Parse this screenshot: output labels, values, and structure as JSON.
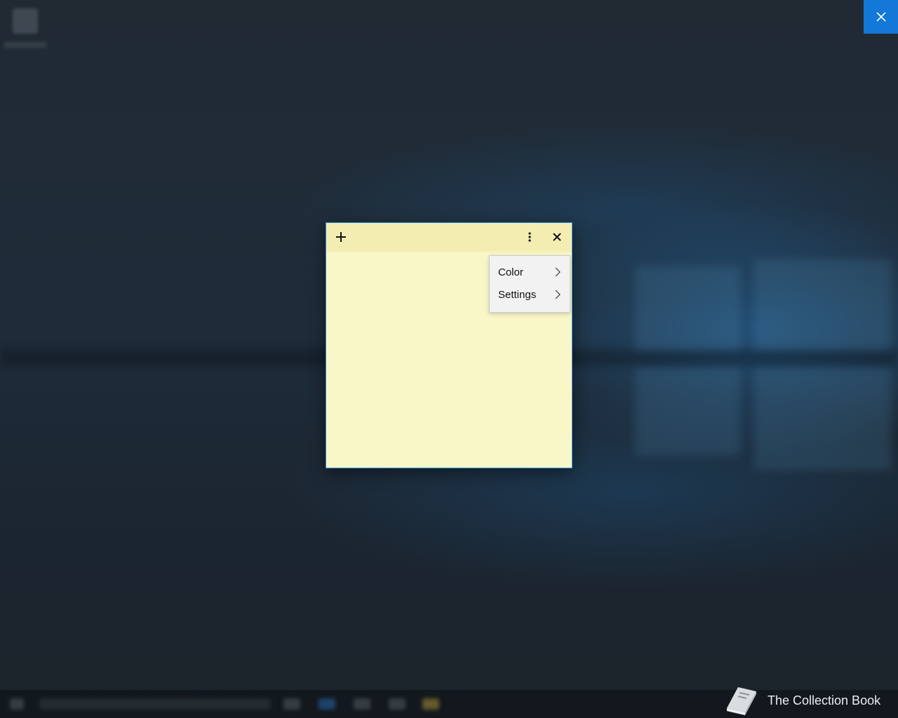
{
  "overlay": {
    "close_icon": "close-icon"
  },
  "note": {
    "add_icon": "plus-icon",
    "menu_icon": "more-vertical-icon",
    "close_icon": "close-icon",
    "background_color": "#f9f6c7",
    "header_color": "#f3edb2"
  },
  "menu": {
    "items": [
      {
        "label": "Color",
        "icon": "chevron-right-icon"
      },
      {
        "label": "Settings",
        "icon": "chevron-right-icon"
      }
    ]
  },
  "watermark": {
    "text": "The Collection Book",
    "icon": "book-icon"
  },
  "colors": {
    "accent": "#1378d8"
  }
}
